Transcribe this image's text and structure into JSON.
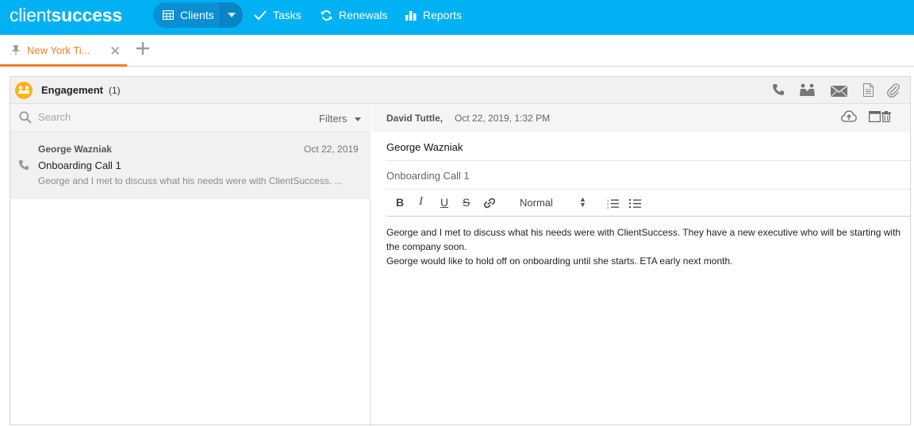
{
  "brand": {
    "part1": "client",
    "part2": "success"
  },
  "nav": {
    "clients": "Clients",
    "tasks": "Tasks",
    "renewals": "Renewals",
    "reports": "Reports"
  },
  "tabs": [
    {
      "label": "New York Ti..."
    }
  ],
  "panel": {
    "title": "Engagement",
    "count": "(1)"
  },
  "search": {
    "placeholder": "Search"
  },
  "filters": {
    "label": "Filters"
  },
  "list": [
    {
      "name": "George Wazniak",
      "date": "Oct 22, 2019",
      "title": "Onboarding Call 1",
      "snippet": "George and I met to discuss what his needs were with ClientSuccess. ..."
    }
  ],
  "detail": {
    "author": "David Tuttle,",
    "timestamp": "Oct 22, 2019, 1:32 PM",
    "contact": "George Wazniak",
    "subject": "Onboarding Call 1",
    "toolbar": {
      "bold": "B",
      "italic": "I",
      "underline": "U",
      "strike": "S",
      "format": "Normal"
    },
    "body_line1": "George and I met to discuss what his needs were with ClientSuccess. They have a new executive who will be starting with the company soon.",
    "body_line2": "George would like to hold off on onboarding until she starts. ETA early next month."
  },
  "colors": {
    "topbar": "#00b2f4",
    "accent_tab": "#f47d20",
    "engagement_icon": "#f9b41b"
  }
}
